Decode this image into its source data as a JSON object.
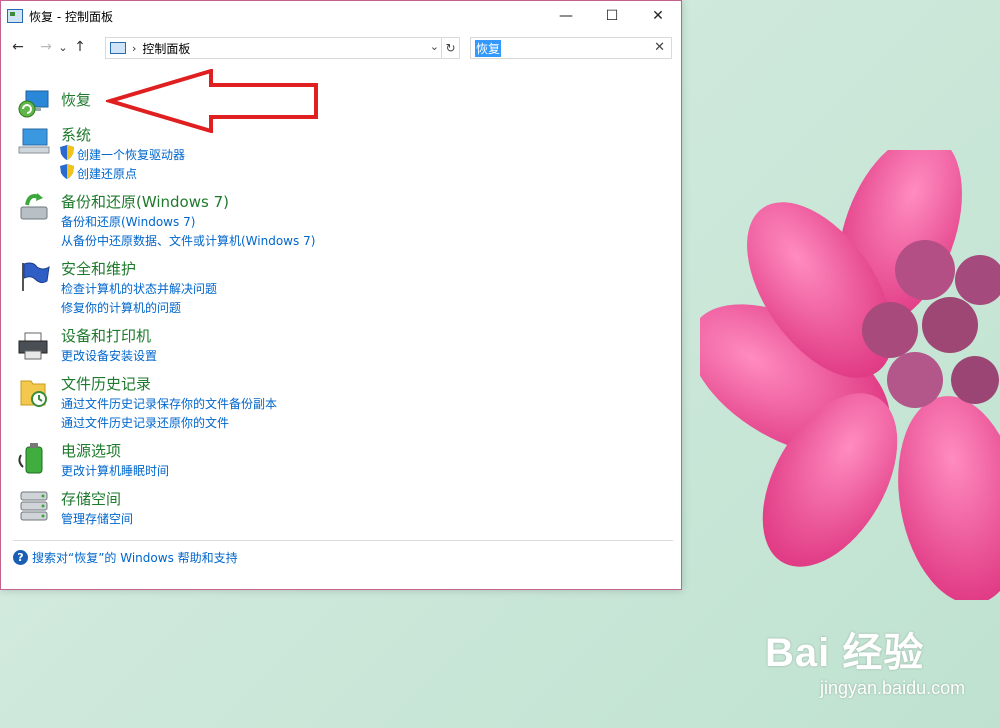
{
  "window": {
    "title": "恢复 - 控制面板",
    "minimize": "—",
    "maximize": "☐",
    "close": "✕"
  },
  "nav": {
    "back": "←",
    "forward": "→",
    "recent": "⌄",
    "up": "↑",
    "breadcrumb_sep": "›",
    "address": "控制面板",
    "address_dropdown": "⌄",
    "refresh": "↻",
    "search_value": "恢复",
    "search_clear": "✕"
  },
  "results": [
    {
      "title": "恢复",
      "icon": "recovery-icon",
      "links": []
    },
    {
      "title": "系统",
      "icon": "system-icon",
      "links": [
        "创建一个恢复驱动器",
        "创建还原点"
      ]
    },
    {
      "title": "备份和还原(Windows 7)",
      "icon": "backup-restore-icon",
      "links": [
        "备份和还原(Windows 7)",
        "从备份中还原数据、文件或计算机(Windows 7)"
      ]
    },
    {
      "title": "安全和维护",
      "icon": "security-flag-icon",
      "links": [
        "检查计算机的状态并解决问题",
        "修复你的计算机的问题"
      ]
    },
    {
      "title": "设备和打印机",
      "icon": "printer-icon",
      "links": [
        "更改设备安装设置"
      ]
    },
    {
      "title": "文件历史记录",
      "icon": "file-history-icon",
      "links": [
        "通过文件历史记录保存你的文件备份副本",
        "通过文件历史记录还原你的文件"
      ]
    },
    {
      "title": "电源选项",
      "icon": "power-options-icon",
      "links": [
        "更改计算机睡眠时间"
      ]
    },
    {
      "title": "存储空间",
      "icon": "storage-spaces-icon",
      "links": [
        "管理存储空间"
      ]
    }
  ],
  "help": {
    "text": "搜索对“恢复”的 Windows 帮助和支持"
  },
  "watermark": {
    "main": "Bai 经验",
    "sub": "jingyan.baidu.com"
  },
  "colors": {
    "title_green": "#1e7a2c",
    "link_blue": "#0066cc",
    "window_border": "#c2628d",
    "arrow_red": "#e02020"
  }
}
